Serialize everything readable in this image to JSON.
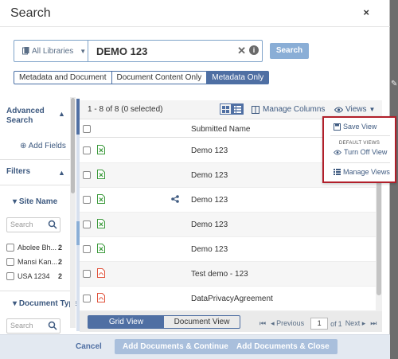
{
  "dialog": {
    "title": "Search",
    "close_glyph": "×"
  },
  "search": {
    "library_label": "All Libraries",
    "query_value": "DEMO 123",
    "clear_glyph": "✕",
    "info_glyph": "i",
    "button_label": "Search"
  },
  "scopes": [
    {
      "label": "Metadata and Document",
      "selected": false
    },
    {
      "label": "Document Content Only",
      "selected": false
    },
    {
      "label": "Metadata Only",
      "selected": true
    }
  ],
  "left_panel": {
    "advanced_search_line1": "Advanced",
    "advanced_search_line2": "Search",
    "add_fields": "Add Fields",
    "filters": "Filters",
    "site_name": "Site Name",
    "site_search_placeholder": "Search",
    "site_items": [
      {
        "label": "Abolee Bh...",
        "count": "2"
      },
      {
        "label": "Mansi Kan...",
        "count": "2"
      },
      {
        "label": "USA 1234",
        "count": "2"
      }
    ],
    "document_type": "Document Type",
    "doctype_search_placeholder": "Search"
  },
  "results": {
    "summary": "1 - 8 of 8 (0 selected)",
    "manage_columns": "Manage Columns",
    "views_label": "Views",
    "column_header": "Submitted Name",
    "rows": [
      {
        "name": "Demo 123",
        "file_type": "excel",
        "shared": false
      },
      {
        "name": "Demo 123",
        "file_type": "excel",
        "shared": false
      },
      {
        "name": "Demo 123",
        "file_type": "excel",
        "shared": true
      },
      {
        "name": "Demo 123",
        "file_type": "excel",
        "shared": false
      },
      {
        "name": "Demo 123",
        "file_type": "excel",
        "shared": false
      },
      {
        "name": "Test demo - 123",
        "file_type": "pdf",
        "shared": false
      },
      {
        "name": "DataPrivacyAgreement",
        "file_type": "pdf",
        "shared": false
      }
    ]
  },
  "views_menu": {
    "save_view": "Save View",
    "default_views_label": "DEFAULT VIEWS",
    "turn_off_view": "Turn Off View",
    "manage_views": "Manage Views"
  },
  "footer": {
    "grid_view": "Grid View",
    "document_view": "Document View",
    "previous": "Previous",
    "page": "1",
    "of": "of",
    "total_pages": "1",
    "next": "Next"
  },
  "actions": {
    "cancel": "Cancel",
    "add_continue": "Add Documents & Continue",
    "add_close": "Add Documents & Close"
  },
  "colors": {
    "primary": "#4f6fa3",
    "highlight_border": "#b11f2a",
    "excel_icon": "#3c9a3c",
    "pdf_icon": "#e0533c"
  }
}
